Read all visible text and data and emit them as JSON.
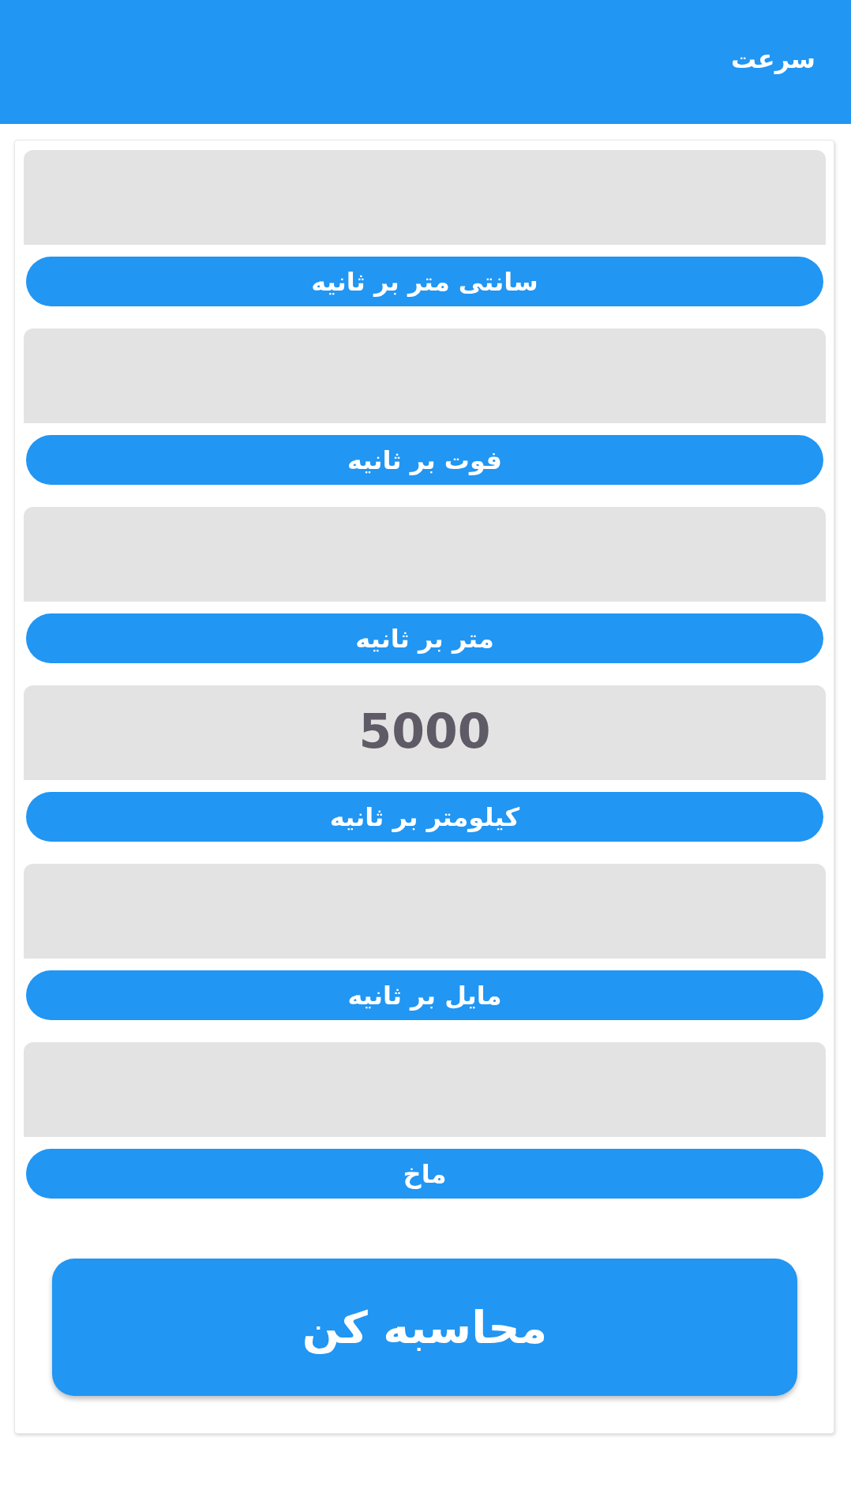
{
  "app_bar": {
    "title": "سرعت"
  },
  "fields": [
    {
      "label": "سانتی متر بر ثانیه"
    },
    {
      "label": "فوت بر ثانیه"
    },
    {
      "label": "متر بر ثانیه"
    },
    {
      "input": {
        "value": "5000"
      },
      "label": "کیلومتر بر ثانیه"
    },
    {
      "label": "مایل بر ثانیه"
    },
    {
      "label": "ماخ"
    }
  ],
  "calculate_button": {
    "label": "محاسبه کن"
  }
}
